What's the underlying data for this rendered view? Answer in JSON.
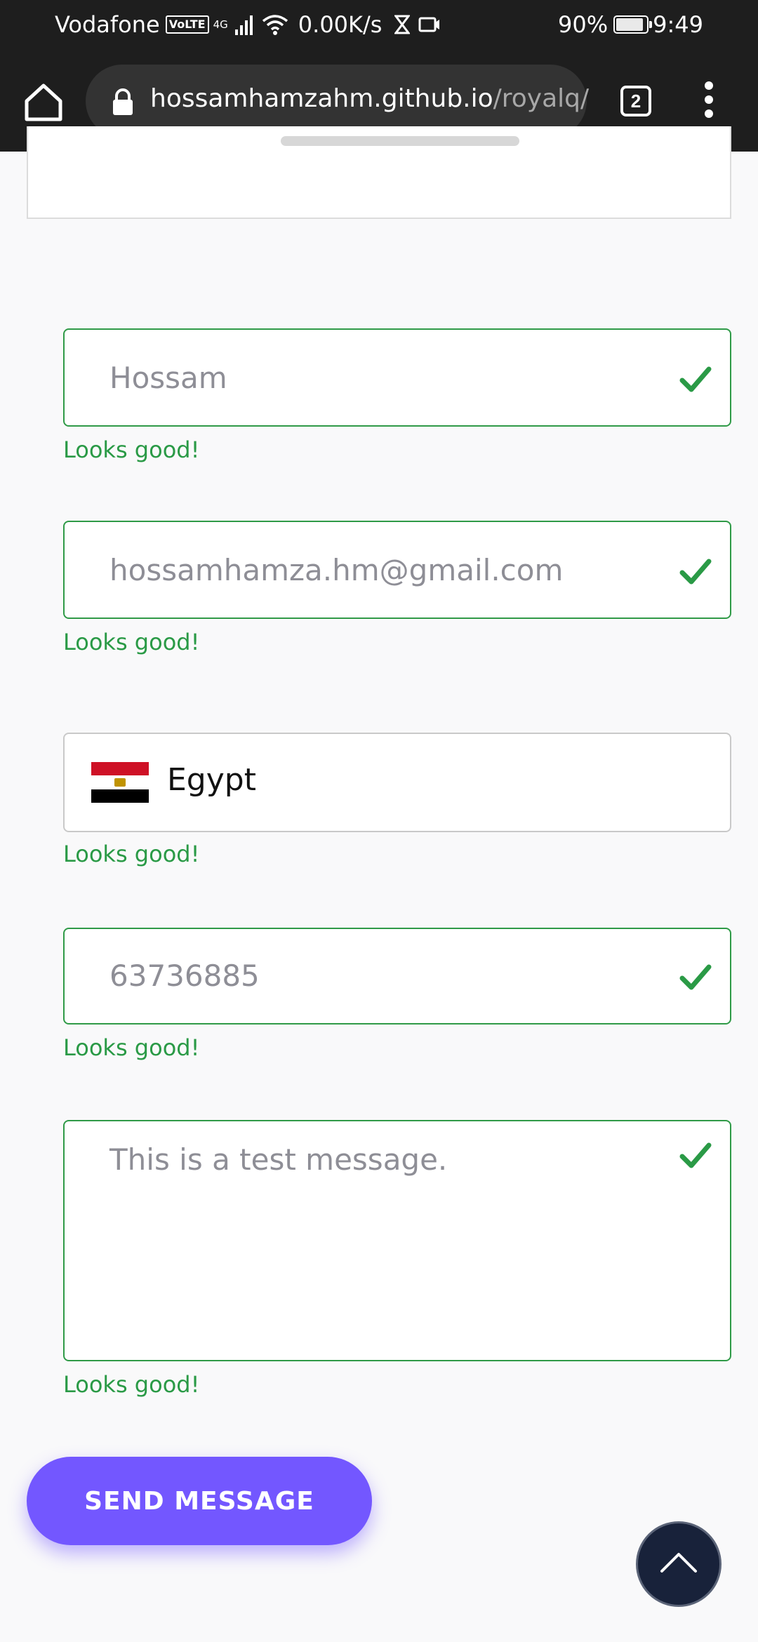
{
  "status_bar": {
    "carrier": "Vodafone",
    "volte": "VoLTE",
    "network": "4G",
    "speed": "0.00K/s",
    "battery": "90%",
    "time": "9:49"
  },
  "browser": {
    "url_domain": "hossamhamzahm.github.io",
    "url_path": "/royalq/",
    "tab_count": "2"
  },
  "form": {
    "name_value": "Hossam",
    "email_value": "hossamhamza.hm@gmail.com",
    "country_value": "Egypt",
    "phone_value": "63736885",
    "message_value": "This is a test message.",
    "valid_feedback": "Looks good!",
    "send_label": "SEND MESSAGE"
  },
  "colors": {
    "valid": "#2a9a46",
    "accent": "#7357ff",
    "scroll_top_bg": "#18223a"
  },
  "icons": [
    "home-icon",
    "lock-icon",
    "tabs-icon",
    "more-vert-icon",
    "check-icon",
    "egypt-flag-icon",
    "chevron-up-icon"
  ]
}
